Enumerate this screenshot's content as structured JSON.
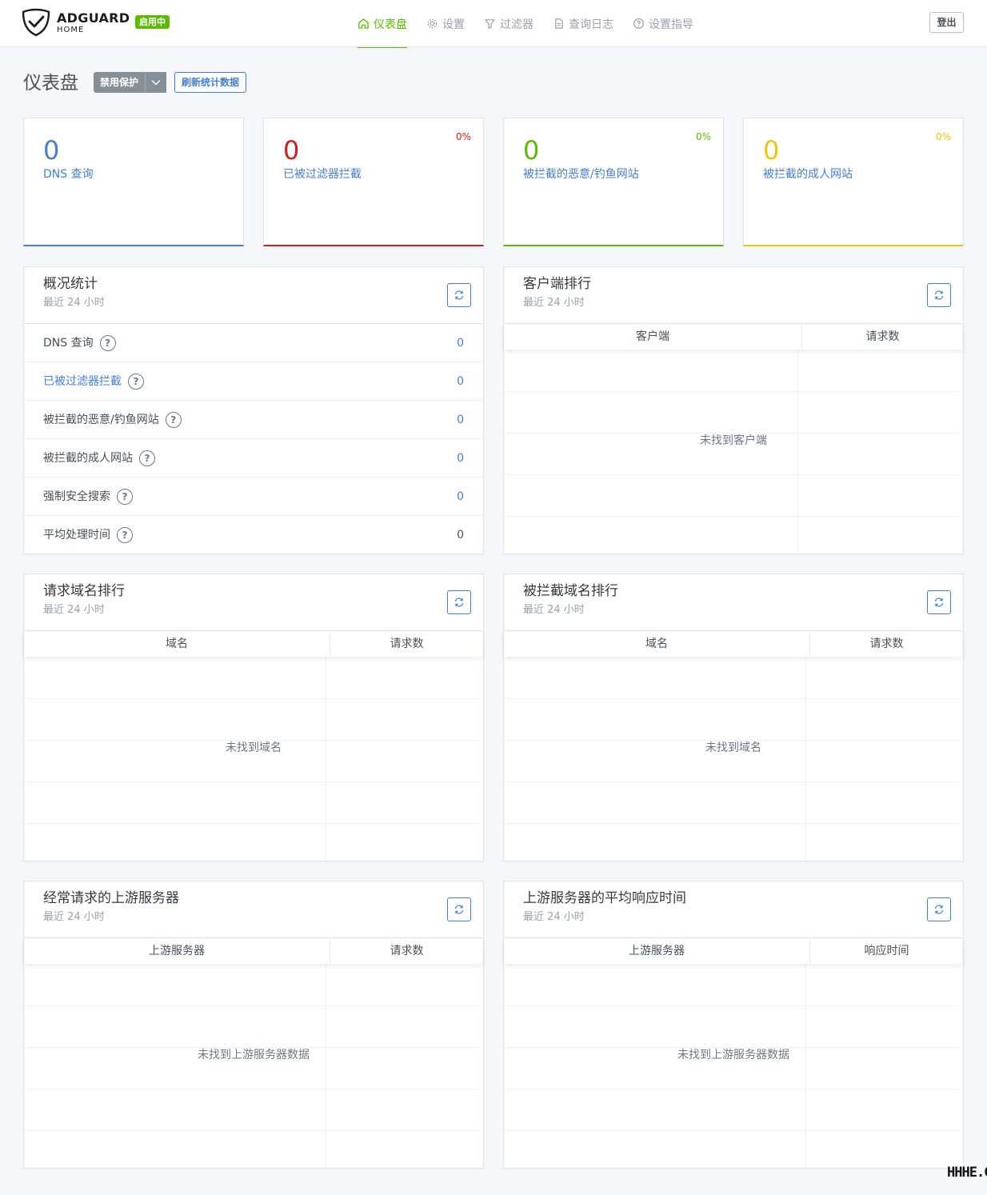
{
  "header": {
    "brand": "ADGUARD",
    "brand_sub": "HOME",
    "status_badge": "启用中",
    "nav": [
      {
        "label": "仪表盘",
        "icon": "home-icon",
        "active": true
      },
      {
        "label": "设置",
        "icon": "gear-icon",
        "active": false
      },
      {
        "label": "过滤器",
        "icon": "filter-icon",
        "active": false
      },
      {
        "label": "查询日志",
        "icon": "document-icon",
        "active": false
      },
      {
        "label": "设置指导",
        "icon": "help-circle-icon",
        "active": false
      }
    ],
    "logout": "登出"
  },
  "page": {
    "title": "仪表盘",
    "disable_protection": "禁用保护",
    "refresh_stats": "刷新统计数据"
  },
  "stat_cards": [
    {
      "value": "0",
      "label": "DNS 查询",
      "percent": "",
      "color": "#467fcf"
    },
    {
      "value": "0",
      "label": "已被过滤器拦截",
      "percent": "0%",
      "color": "#cd201f"
    },
    {
      "value": "0",
      "label": "被拦截的恶意/钓鱼网站",
      "percent": "0%",
      "color": "#5eba00"
    },
    {
      "value": "0",
      "label": "被拦截的成人网站",
      "percent": "0%",
      "color": "#f1c40f"
    }
  ],
  "overview": {
    "title": "概况统计",
    "subtitle": "最近 24 小时",
    "rows": [
      {
        "label": "DNS 查询",
        "value": "0"
      },
      {
        "label": "已被过滤器拦截",
        "value": "0"
      },
      {
        "label": "被拦截的恶意/钓鱼网站",
        "value": "0"
      },
      {
        "label": "被拦截的成人网站",
        "value": "0"
      },
      {
        "label": "强制安全搜索",
        "value": "0"
      },
      {
        "label": "平均处理时间",
        "value": "0"
      }
    ]
  },
  "clients": {
    "title": "客户端排行",
    "subtitle": "最近 24 小时",
    "col1": "客户端",
    "col2": "请求数",
    "empty": "未找到客户端"
  },
  "queried_domains": {
    "title": "请求域名排行",
    "subtitle": "最近 24 小时",
    "col1": "域名",
    "col2": "请求数",
    "empty": "未找到域名"
  },
  "blocked_domains": {
    "title": "被拦截域名排行",
    "subtitle": "最近 24 小时",
    "col1": "域名",
    "col2": "请求数",
    "empty": "未找到域名"
  },
  "upstreams": {
    "title": "经常请求的上游服务器",
    "subtitle": "最近 24 小时",
    "col1": "上游服务器",
    "col2": "请求数",
    "empty": "未找到上游服务器数据"
  },
  "upstream_avg": {
    "title": "上游服务器的平均响应时间",
    "subtitle": "最近 24 小时",
    "col1": "上游服务器",
    "col2": "响应时间",
    "empty": "未找到上游服务器数据"
  },
  "watermark": "HHHE.CN"
}
